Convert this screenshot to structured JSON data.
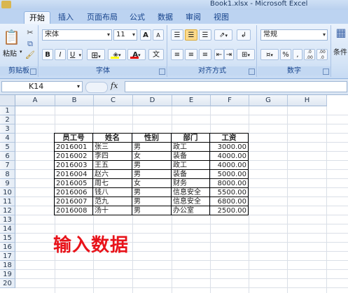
{
  "window": {
    "title": "Book1.xlsx - Microsoft Excel"
  },
  "tabs": [
    {
      "label": "开始",
      "active": true
    },
    {
      "label": "插入"
    },
    {
      "label": "页面布局"
    },
    {
      "label": "公式"
    },
    {
      "label": "数据"
    },
    {
      "label": "审阅"
    },
    {
      "label": "视图"
    }
  ],
  "ribbon": {
    "clipboard": {
      "paste_label": "粘贴",
      "group_label": "剪贴板"
    },
    "font": {
      "font_name": "宋体",
      "font_size": "11",
      "grow": "A",
      "shrink": "A",
      "bold": "B",
      "italic": "I",
      "underline": "U",
      "font_color_glyph": "A",
      "wen": "文",
      "group_label": "字体"
    },
    "align": {
      "group_label": "对齐方式"
    },
    "number": {
      "format": "常规",
      "percent": "%",
      "comma": ",",
      "group_label": "数字",
      "increase_decimal": ".0 .00",
      "decrease_decimal": ".00 .0"
    },
    "styles": {
      "label": "条件"
    }
  },
  "formula_bar": {
    "name_box": "K14",
    "fx": "fx",
    "formula": ""
  },
  "sheet": {
    "columns": [
      "A",
      "B",
      "C",
      "D",
      "E",
      "F",
      "G",
      "H"
    ],
    "rows": [
      "1",
      "2",
      "3",
      "4",
      "5",
      "6",
      "7",
      "8",
      "9",
      "10",
      "11",
      "12",
      "13",
      "14",
      "15",
      "16",
      "17",
      "18",
      "19",
      "20"
    ],
    "table": {
      "headers": [
        "员工号",
        "姓名",
        "性别",
        "部门",
        "工资"
      ],
      "rows": [
        [
          "2016001",
          "张三",
          "男",
          "政工",
          "3000.00"
        ],
        [
          "2016002",
          "李四",
          "女",
          "装备",
          "4000.00"
        ],
        [
          "2016003",
          "王五",
          "男",
          "政工",
          "4000.00"
        ],
        [
          "2016004",
          "赵六",
          "男",
          "装备",
          "5000.00"
        ],
        [
          "2016005",
          "周七",
          "女",
          "财务",
          "8000.00"
        ],
        [
          "2016006",
          "钱八",
          "男",
          "信息安全",
          "5500.00"
        ],
        [
          "2016007",
          "范九",
          "男",
          "信息安全",
          "6800.00"
        ],
        [
          "2016008",
          "汤十",
          "男",
          "办公室",
          "2500.00"
        ]
      ]
    },
    "annotation": "输入数据"
  }
}
